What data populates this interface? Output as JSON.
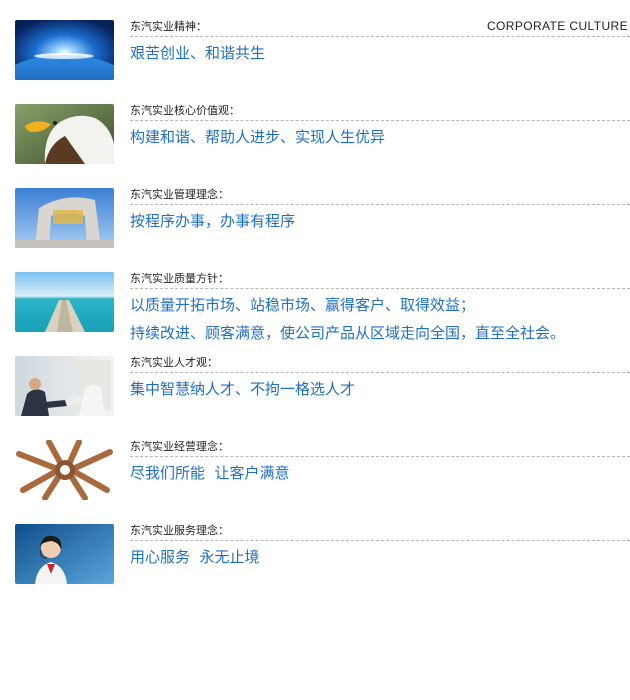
{
  "header": {
    "tag": "CORPORATE CULTURE"
  },
  "sections": [
    {
      "label": "东汽实业精神：",
      "lines": [
        "艰苦创业、和谐共生"
      ],
      "image": "earth-sunrise-image"
    },
    {
      "label": "东汽实业核心价值观：",
      "lines": [
        "构建和谐、帮助人进步、实现人生优异"
      ],
      "image": "eagle-image"
    },
    {
      "label": "东汽实业管理理念：",
      "lines": [
        "按程序办事，办事有程序"
      ],
      "image": "arch-building-image"
    },
    {
      "label": "东汽实业质量方针：",
      "lines": [
        "以质量开拓市场、站稳市场、赢得客户、取得效益；",
        "持续改进、顾客满意，使公司产品从区域走向全国，直至全社会。"
      ],
      "image": "ocean-pier-image"
    },
    {
      "label": "东汽实业人才观：",
      "lines": [
        "集中智慧纳人才、不拘一格选人才"
      ],
      "image": "handshake-image"
    },
    {
      "label": "东汽实业经营理念：",
      "lines": [
        "尽我们所能  让客户满意"
      ],
      "image": "linked-hands-image"
    },
    {
      "label": "东汽实业服务理念：",
      "lines": [
        "用心服务  永无止境"
      ],
      "image": "service-agent-image"
    }
  ]
}
